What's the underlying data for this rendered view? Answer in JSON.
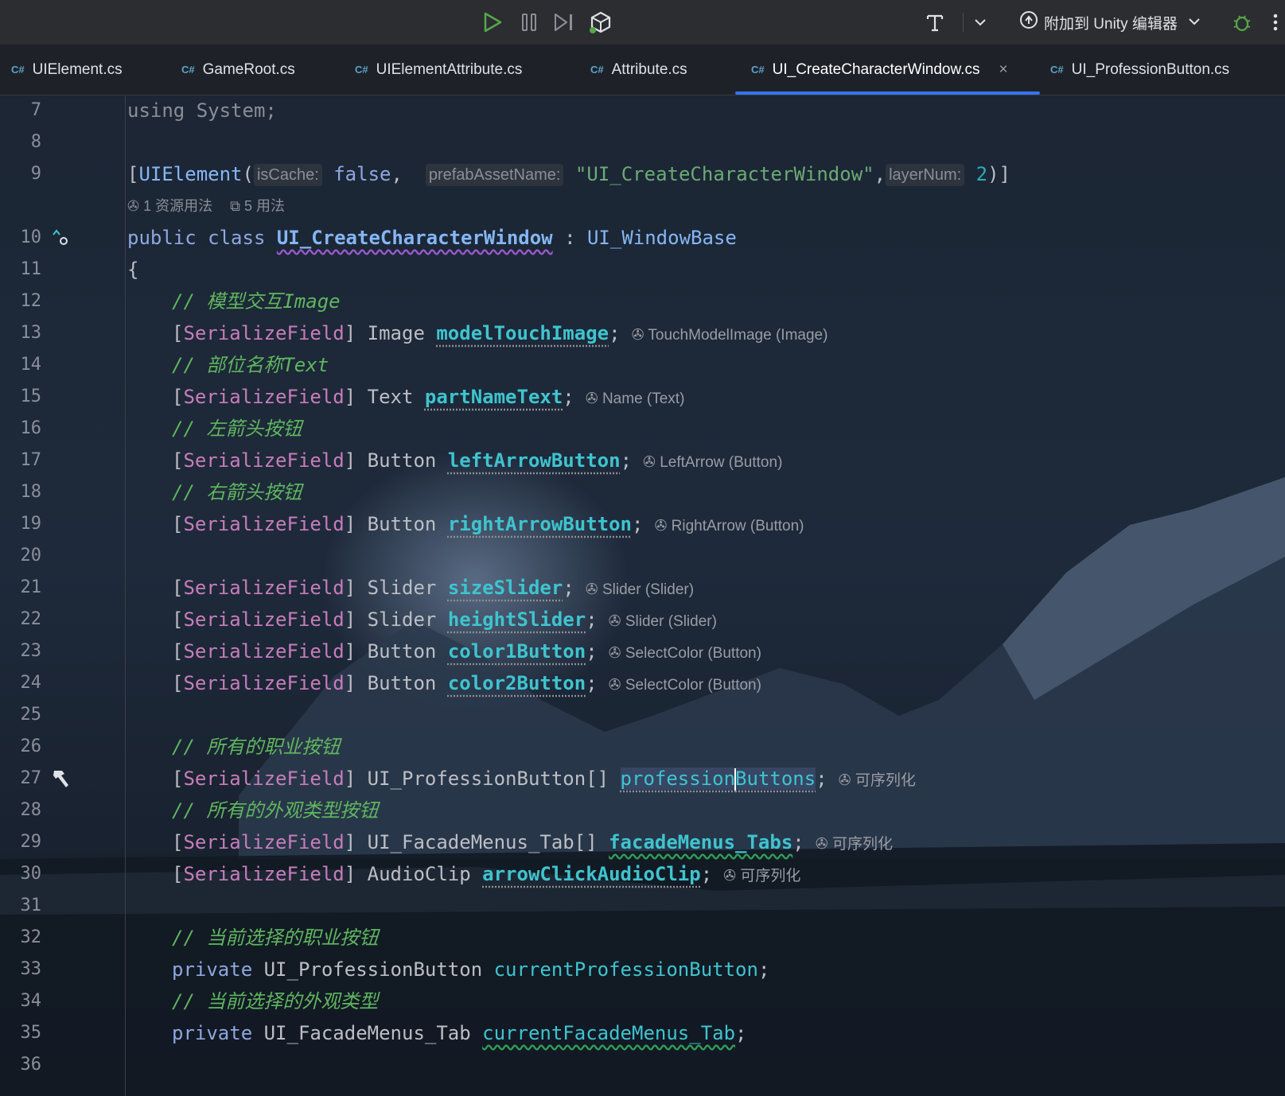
{
  "toolbar": {
    "icons": [
      "run-icon",
      "pause-icon",
      "step-icon",
      "unity-debug-icon",
      "format-icon",
      "chevron-down-icon",
      "attach-unity-icon",
      "chevron-down-icon",
      "bug-icon",
      "more-icon"
    ],
    "attach_label": "附加到 Unity 编辑器"
  },
  "tabs": [
    {
      "label": "UIElement.cs",
      "badge": "C#"
    },
    {
      "label": "GameRoot.cs",
      "badge": "C#"
    },
    {
      "label": "UIElementAttribute.cs",
      "badge": "C#"
    },
    {
      "label": "Attribute.cs",
      "badge": "C#"
    },
    {
      "label": "UI_CreateCharacterWindow.cs",
      "badge": "C#",
      "active": true,
      "close": "×"
    },
    {
      "label": "UI_ProfessionButton.cs",
      "badge": "C#"
    }
  ],
  "editor": {
    "line_numbers": [
      "7",
      "8",
      "9",
      "",
      "10",
      "11",
      "12",
      "13",
      "14",
      "15",
      "16",
      "17",
      "18",
      "19",
      "20",
      "21",
      "22",
      "23",
      "24",
      "25",
      "26",
      "27",
      "28",
      "29",
      "30",
      "31",
      "32",
      "33",
      "34",
      "35",
      "36"
    ],
    "code_lens": {
      "refs": "1 资源用法",
      "usages": "5 用法"
    },
    "lines": {
      "l7": {
        "kw": "using",
        "rest": " System;"
      },
      "l9": {
        "open": "[",
        "attr": "UIElement",
        "p1": "(",
        "h1": "isCache:",
        "v1": "false",
        "c1": ",  ",
        "h2": "prefabAssetName:",
        "v2": "\"UI_CreateCharacterWindow\"",
        "c2": ",",
        "h3": "layerNum:",
        "v3": "2",
        "close": ")]"
      },
      "l10": {
        "kw": "public class ",
        "cls": "UI_CreateCharacterWindow",
        "colon": " : ",
        "base": "UI_WindowBase"
      },
      "l11": "{",
      "l12": "// 模型交互Image",
      "l13": {
        "type": "Image",
        "field": "modelTouchImage",
        "hint": "TouchModelImage (Image)"
      },
      "l14": "// 部位名称Text",
      "l15": {
        "type": "Text",
        "field": "partNameText",
        "hint": "Name (Text)"
      },
      "l16": "// 左箭头按钮",
      "l17": {
        "type": "Button",
        "field": "leftArrowButton",
        "hint": "LeftArrow (Button)"
      },
      "l18": "// 右箭头按钮",
      "l19": {
        "type": "Button",
        "field": "rightArrowButton",
        "hint": "RightArrow (Button)"
      },
      "l21": {
        "type": "Slider",
        "field": "sizeSlider",
        "hint": "Slider (Slider)"
      },
      "l22": {
        "type": "Slider",
        "field": "heightSlider",
        "hint": "Slider (Slider)"
      },
      "l23": {
        "type": "Button",
        "field": "color1Button",
        "hint": "SelectColor (Button)"
      },
      "l24": {
        "type": "Button",
        "field": "color2Button",
        "hint": "SelectColor (Button)"
      },
      "l26": "// 所有的职业按钮",
      "l27": {
        "type": "UI_ProfessionButton[]",
        "field_a": "profession",
        "field_b": "Buttons",
        "hint": "可序列化"
      },
      "l28": "// 所有的外观类型按钮",
      "l29": {
        "type": "UI_FacadeMenus_Tab[]",
        "field": "facadeMenus_Tabs",
        "hint": "可序列化"
      },
      "l30": {
        "type": "AudioClip",
        "field": "arrowClickAudioClip",
        "hint": "可序列化"
      },
      "l32": "// 当前选择的职业按钮",
      "l33": {
        "kw": "private",
        "type": "UI_ProfessionButton",
        "field": "currentProfessionButton"
      },
      "l34": "// 当前选择的外观类型",
      "l35": {
        "kw": "private",
        "type": "UI_FacadeMenus_Tab",
        "field": "currentFacadeMenus_Tab"
      }
    },
    "serialize_attr": "SerializeField",
    "semicolon": ";"
  }
}
